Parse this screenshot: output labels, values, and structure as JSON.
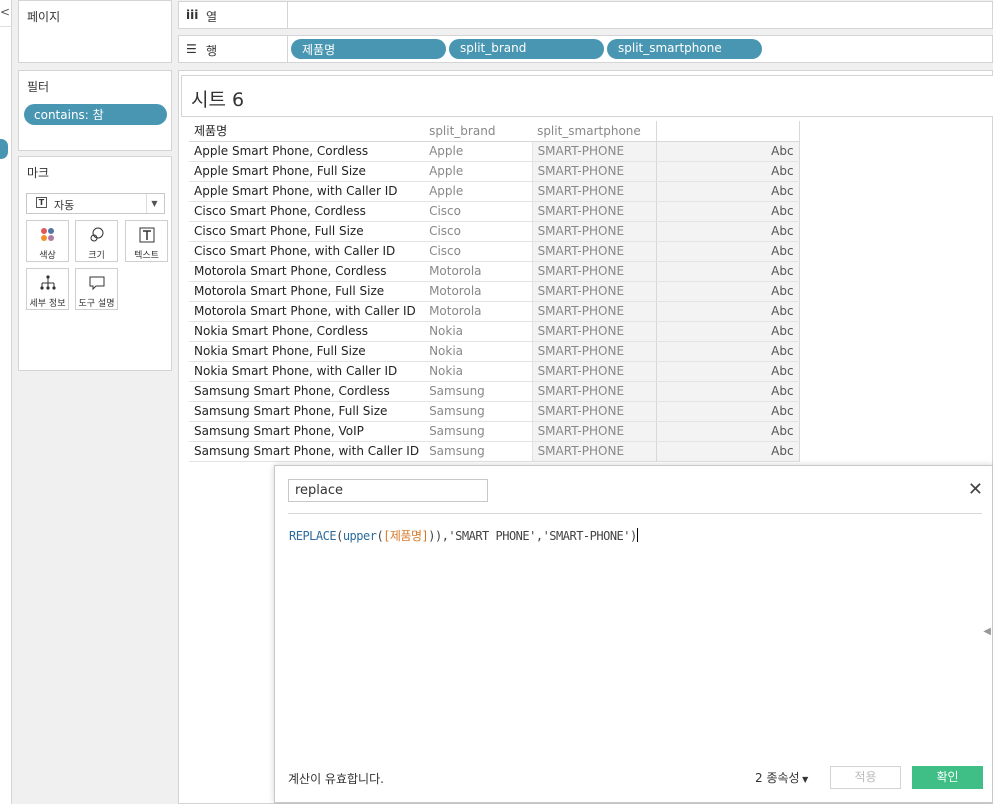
{
  "left_edge": {
    "collapse_icon": "chevron-left"
  },
  "pages": {
    "title": "페이지"
  },
  "filters": {
    "title": "필터",
    "pills": [
      "contains: 참"
    ]
  },
  "marks": {
    "title": "마크",
    "type": "자동",
    "buttons": {
      "color": "색상",
      "size": "크기",
      "text": "텍스트",
      "detail": "세부 정보",
      "tooltip": "도구 설명"
    }
  },
  "shelves": {
    "columns": {
      "label": "열",
      "icon": "columns-icon"
    },
    "rows": {
      "label": "행",
      "icon": "rows-icon",
      "pills": [
        "제품명",
        "split_brand",
        "split_smartphone"
      ]
    }
  },
  "sheet": {
    "title": "시트 6",
    "headers": [
      "제품명",
      "split_brand",
      "split_smartphone",
      ""
    ],
    "rows": [
      [
        "Apple Smart Phone, Cordless",
        "Apple",
        "SMART-PHONE",
        "Abc"
      ],
      [
        "Apple Smart Phone, Full Size",
        "Apple",
        "SMART-PHONE",
        "Abc"
      ],
      [
        "Apple Smart Phone, with Caller ID",
        "Apple",
        "SMART-PHONE",
        "Abc"
      ],
      [
        "Cisco Smart Phone, Cordless",
        "Cisco",
        "SMART-PHONE",
        "Abc"
      ],
      [
        "Cisco Smart Phone, Full Size",
        "Cisco",
        "SMART-PHONE",
        "Abc"
      ],
      [
        "Cisco Smart Phone, with Caller ID",
        "Cisco",
        "SMART-PHONE",
        "Abc"
      ],
      [
        "Motorola Smart Phone, Cordless",
        "Motorola",
        "SMART-PHONE",
        "Abc"
      ],
      [
        "Motorola Smart Phone, Full Size",
        "Motorola",
        "SMART-PHONE",
        "Abc"
      ],
      [
        "Motorola Smart Phone, with Caller ID",
        "Motorola",
        "SMART-PHONE",
        "Abc"
      ],
      [
        "Nokia Smart Phone, Cordless",
        "Nokia",
        "SMART-PHONE",
        "Abc"
      ],
      [
        "Nokia Smart Phone, Full Size",
        "Nokia",
        "SMART-PHONE",
        "Abc"
      ],
      [
        "Nokia Smart Phone, with Caller ID",
        "Nokia",
        "SMART-PHONE",
        "Abc"
      ],
      [
        "Samsung Smart Phone, Cordless",
        "Samsung",
        "SMART-PHONE",
        "Abc"
      ],
      [
        "Samsung Smart Phone, Full Size",
        "Samsung",
        "SMART-PHONE",
        "Abc"
      ],
      [
        "Samsung Smart Phone, VoIP",
        "Samsung",
        "SMART-PHONE",
        "Abc"
      ],
      [
        "Samsung Smart Phone, with Caller ID",
        "Samsung",
        "SMART-PHONE",
        "Abc"
      ]
    ]
  },
  "calc": {
    "name": "replace",
    "formula": {
      "fn": "REPLACE",
      "open1": "(",
      "inner_fn": "upper",
      "open2": "(",
      "field": "[제품명]",
      "close2": ")",
      "rest": "),'SMART PHONE','SMART-PHONE')"
    },
    "status": "계산이 유효합니다.",
    "dependencies": "2 종속성",
    "apply_label": "적용",
    "ok_label": "확인"
  },
  "colors": {
    "pill": "#4996b2",
    "ok_button": "#3fbf86",
    "keyword": "#2d6b9e",
    "field": "#d97a29"
  }
}
